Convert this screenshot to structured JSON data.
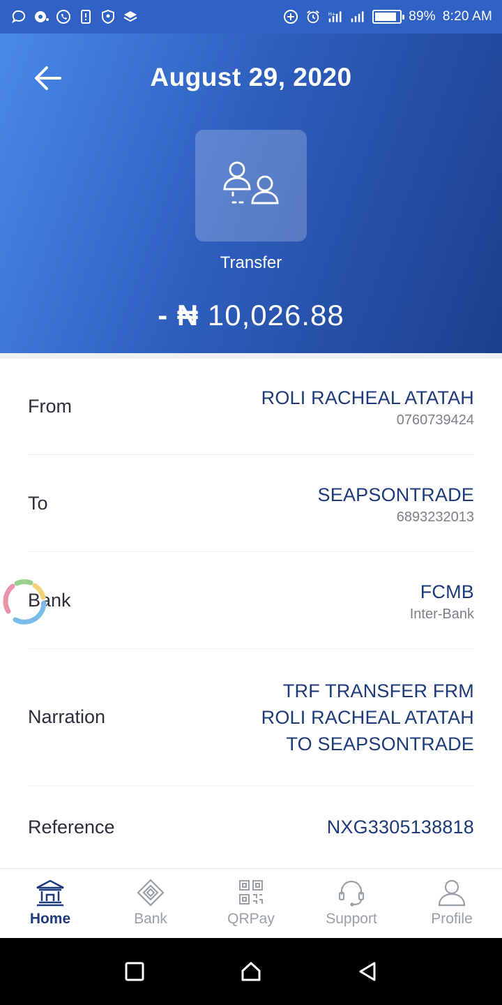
{
  "status_bar": {
    "battery": "89%",
    "time": "8:20 AM",
    "battery_level": 0.89
  },
  "header": {
    "title": "August 29, 2020",
    "transaction_type": "Transfer",
    "amount_sign": "- ₦",
    "amount_value": "10,026.88",
    "icon": "transfer-users-icon"
  },
  "details": {
    "from": {
      "label": "From",
      "name": "ROLI RACHEAL ATATAH",
      "account": "0760739424"
    },
    "to": {
      "label": "To",
      "name": "SEAPSONTRADE",
      "account": "6893232013"
    },
    "bank": {
      "label": "Bank",
      "name": "FCMB",
      "type": "Inter-Bank"
    },
    "narration": {
      "label": "Narration",
      "line1": "TRF TRANSFER FRM",
      "line2": "ROLI RACHEAL ATATAH",
      "line3": "TO SEAPSONTRADE"
    },
    "reference": {
      "label": "Reference",
      "value": "NXG3305138818"
    }
  },
  "bottom_nav": {
    "items": [
      {
        "label": "Home",
        "icon": "bank-building-icon",
        "active": true
      },
      {
        "label": "Bank",
        "icon": "diamond-icon",
        "active": false
      },
      {
        "label": "QRPay",
        "icon": "qr-code-icon",
        "active": false
      },
      {
        "label": "Support",
        "icon": "headset-icon",
        "active": false
      },
      {
        "label": "Profile",
        "icon": "user-icon",
        "active": false
      }
    ]
  },
  "colors": {
    "accent": "#1d3a7a",
    "header_start": "#4a8ae6",
    "header_end": "#1c3f8c",
    "inactive": "#9aa0a8"
  }
}
